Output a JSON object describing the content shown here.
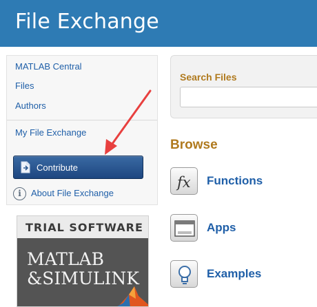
{
  "header": {
    "title": "File Exchange"
  },
  "sidebar": {
    "links": [
      "MATLAB Central",
      "Files",
      "Authors"
    ],
    "my_link": "My File Exchange",
    "contribute_label": "Contribute",
    "about_label": "About File Exchange"
  },
  "trial": {
    "heading": "TRIAL SOFTWARE",
    "line1": "MATLAB",
    "line2": "&SIMULINK"
  },
  "search": {
    "label": "Search Files",
    "value": "",
    "placeholder": ""
  },
  "browse": {
    "title": "Browse",
    "items": [
      {
        "label": "Functions",
        "icon": "function-fx-icon"
      },
      {
        "label": "Apps",
        "icon": "app-window-icon"
      },
      {
        "label": "Examples",
        "icon": "lightbulb-icon"
      }
    ]
  },
  "colors": {
    "header_bg": "#2e7bb4",
    "link": "#1f5fa8",
    "accent_gold": "#b07a1e",
    "button_bg": "#1d4680",
    "arrow": "#e8403f"
  }
}
